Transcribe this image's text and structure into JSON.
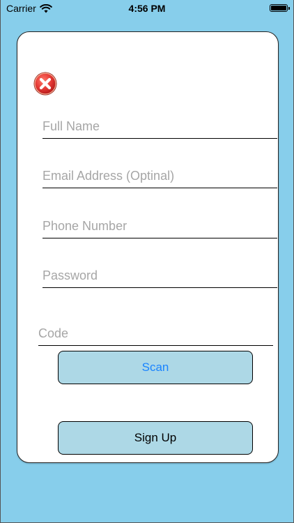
{
  "status_bar": {
    "carrier": "Carrier",
    "time": "4:56 PM"
  },
  "form": {
    "full_name": {
      "placeholder": "Full Name",
      "value": ""
    },
    "email": {
      "placeholder": "Email Address (Optinal)",
      "value": ""
    },
    "phone": {
      "placeholder": "Phone Number",
      "value": ""
    },
    "password": {
      "placeholder": "Password",
      "value": ""
    },
    "code": {
      "placeholder": "Code",
      "value": ""
    }
  },
  "buttons": {
    "scan_label": "Scan",
    "signup_label": "Sign Up"
  },
  "icons": {
    "status_wifi": "wifi-icon",
    "status_battery": "battery-icon",
    "close": "close-icon"
  },
  "colors": {
    "background": "#87CEEB",
    "card": "#FFFFFF",
    "button_fill": "#ADD8E6",
    "scan_text": "#1A84FF",
    "close_red": "#E53935"
  }
}
